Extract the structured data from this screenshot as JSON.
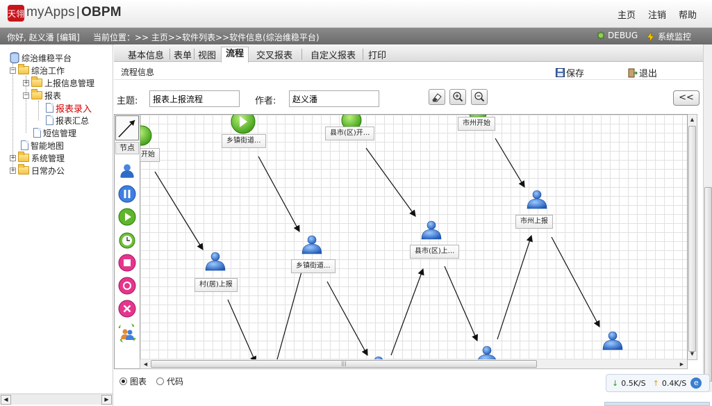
{
  "header": {
    "logo_mark": "天翎",
    "brand_primary": "myApps",
    "brand_sep": "|",
    "brand_secondary": "OBPM",
    "links": [
      "主页",
      "注销",
      "帮助"
    ]
  },
  "infobar": {
    "greeting": "你好, 赵义潘 [编辑]",
    "location": "当前位置：>> 主页>>软件列表>>软件信息(综治维稳平台)",
    "debug_label": "DEBUG",
    "monitor_label": "系统监控"
  },
  "tree": {
    "root": "综治维稳平台",
    "items": [
      "综治工作",
      "上报信息管理",
      "报表",
      "报表录入",
      "报表汇总",
      "短信管理",
      "智能地图",
      "系统管理",
      "日常办公"
    ]
  },
  "tabs": [
    "基本信息",
    "表单",
    "视图",
    "流程",
    "交叉报表",
    "自定义报表",
    "打印"
  ],
  "active_tab": "流程",
  "subheader": {
    "title": "流程信息",
    "save": "保存",
    "exit": "退出"
  },
  "form": {
    "subject_label": "主题:",
    "subject_value": "报表上报流程",
    "author_label": "作者:",
    "author_value": "赵义潘",
    "collapse": "<<"
  },
  "palette": {
    "node_label": "节点"
  },
  "nodes": [
    "开始",
    "乡镇街道...",
    "县市(区)开...",
    "市州开始",
    "村(居)上报",
    "乡镇街道...",
    "县市(区)上...",
    "市州上报"
  ],
  "bottom": {
    "mode_chart": "图表",
    "mode_code": "代码",
    "speed_down": "0.5K/S",
    "speed_up": "0.4K/S",
    "colors": {
      "accent": "#3a7fd0",
      "start_node": "#5fb52b",
      "person": "#2f6cc8"
    }
  }
}
